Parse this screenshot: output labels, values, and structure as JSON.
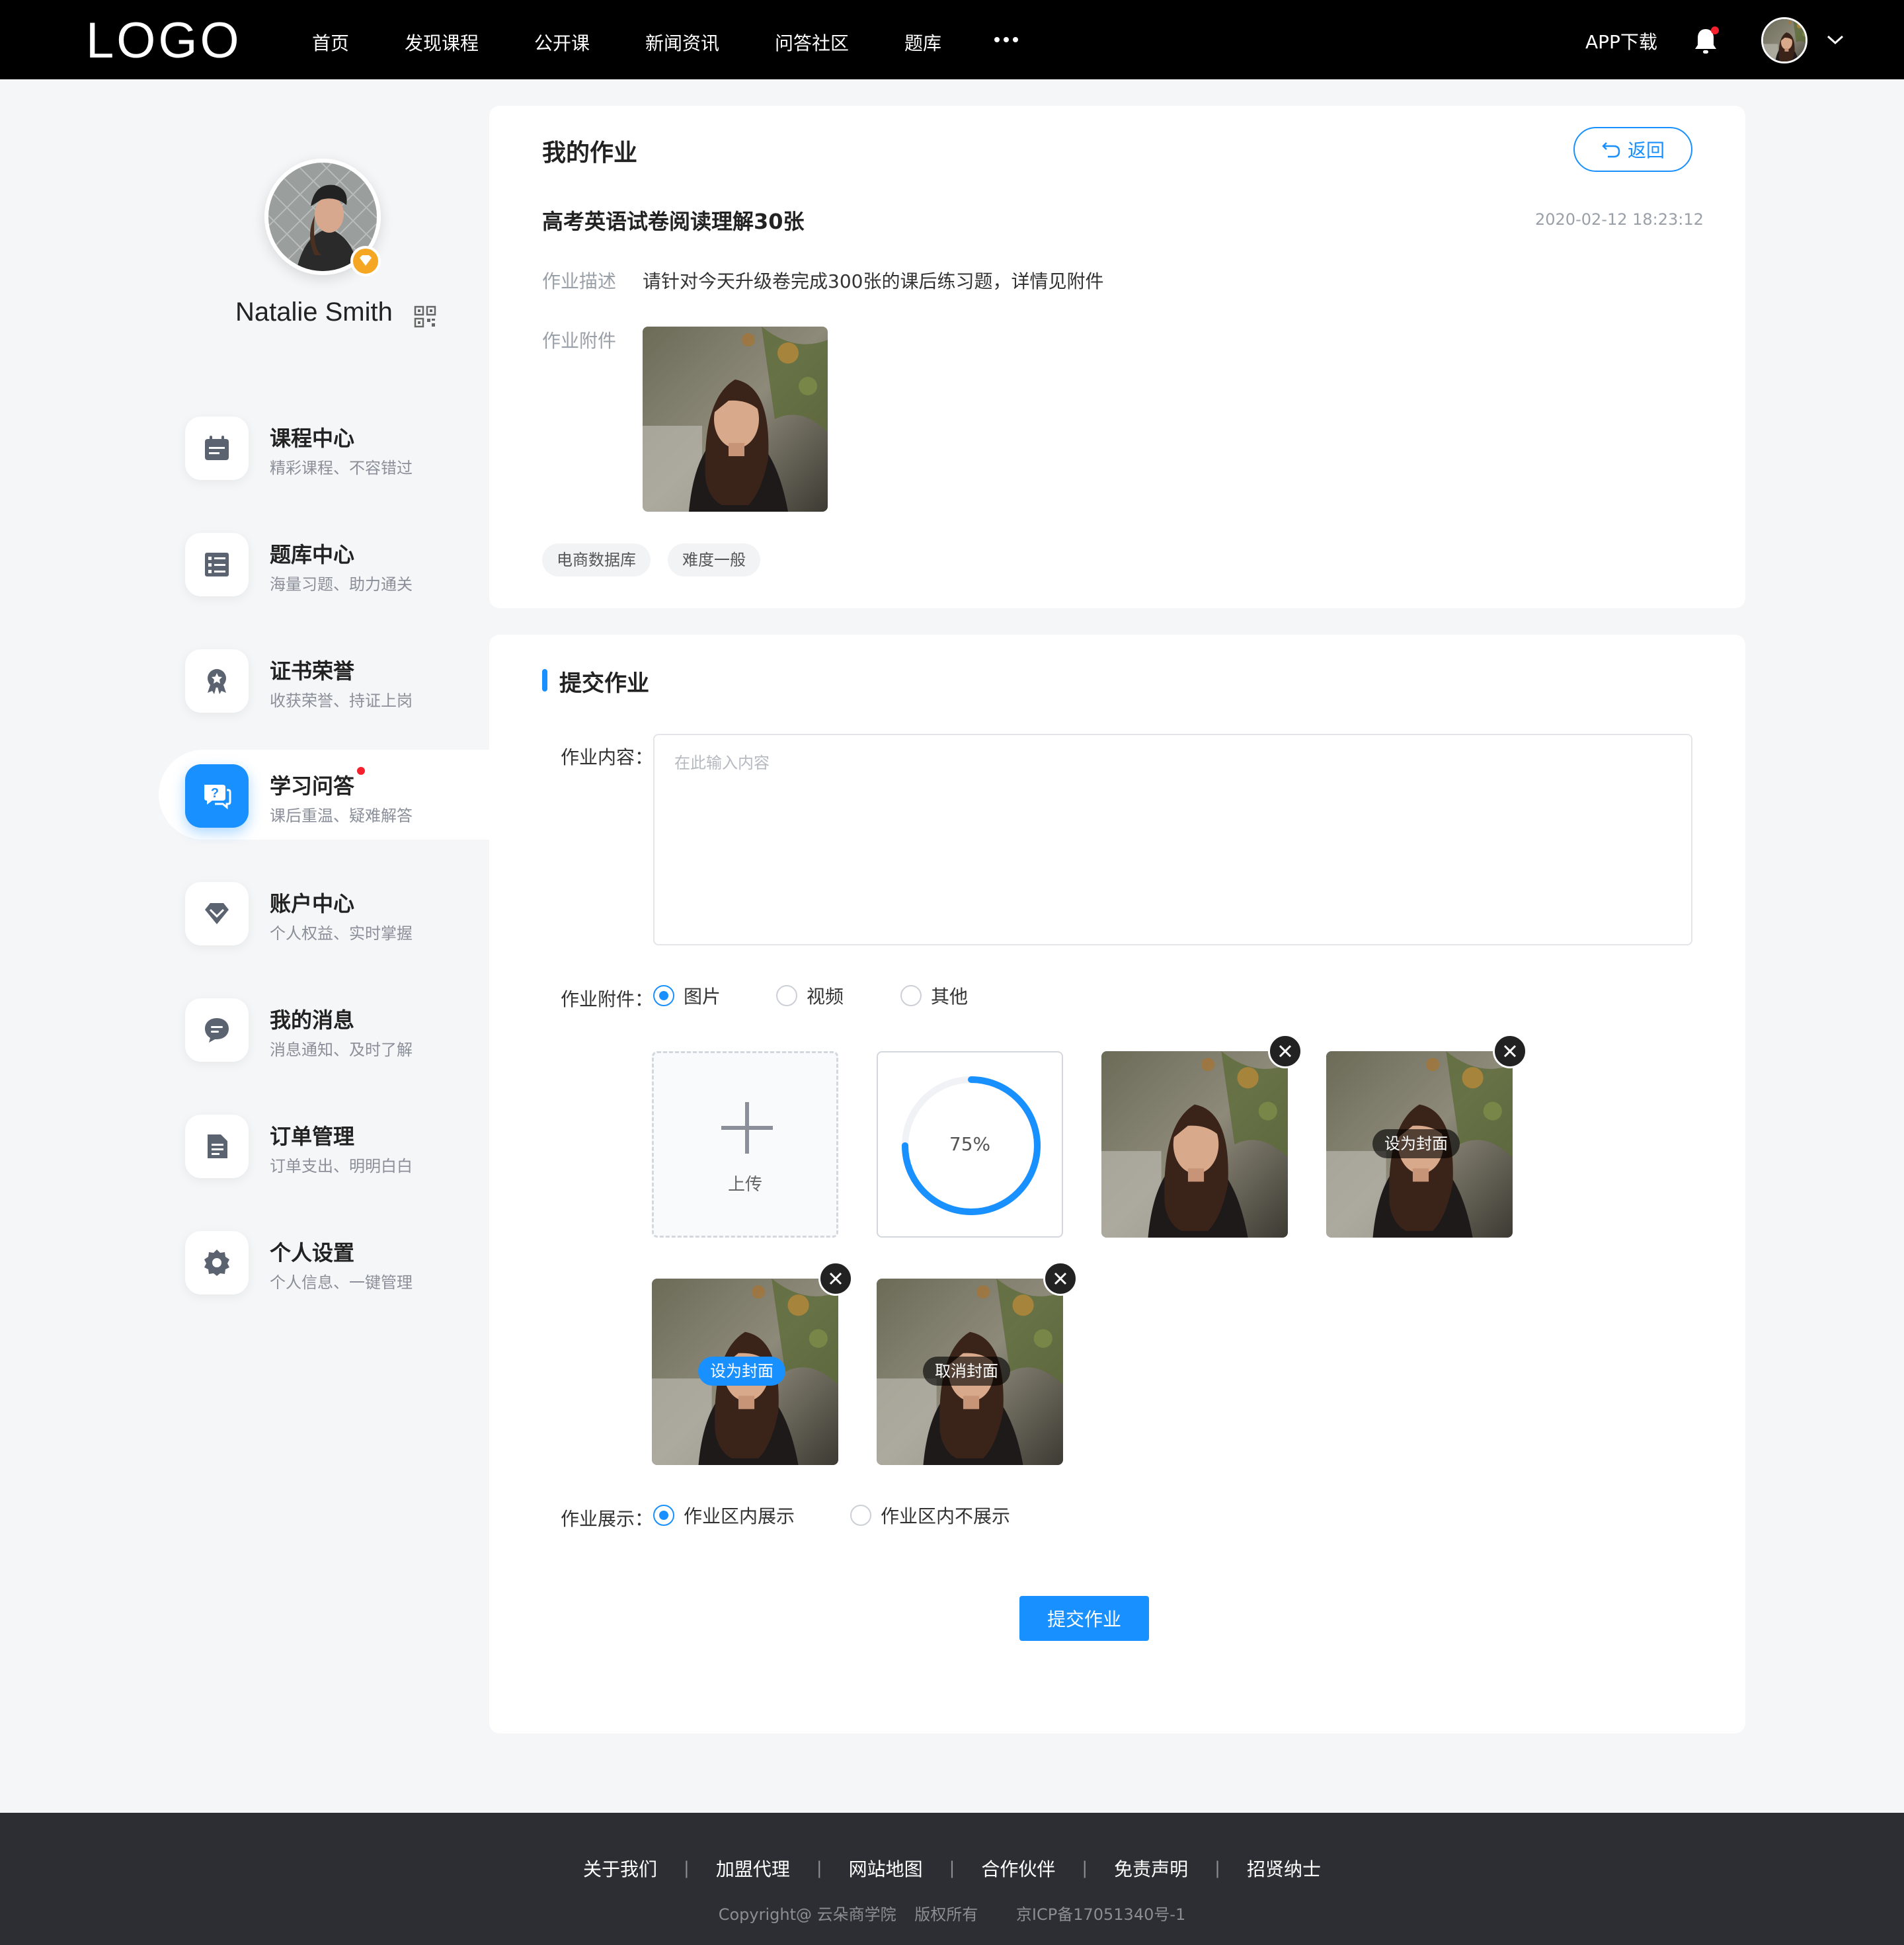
{
  "header": {
    "logo": "LOGO",
    "nav": [
      "首页",
      "发现课程",
      "公开课",
      "新闻资讯",
      "问答社区",
      "题库"
    ],
    "app_download": "APP下载"
  },
  "profile": {
    "name": "Natalie Smith"
  },
  "sidebar": {
    "items": [
      {
        "title": "课程中心",
        "sub": "精彩课程、不容错过",
        "icon": "calendar-icon"
      },
      {
        "title": "题库中心",
        "sub": "海量习题、助力通关",
        "icon": "list-icon"
      },
      {
        "title": "证书荣誉",
        "sub": "收获荣誉、持证上岗",
        "icon": "award-icon"
      },
      {
        "title": "学习问答",
        "sub": "课后重温、疑难解答",
        "icon": "question-chat-icon"
      },
      {
        "title": "账户中心",
        "sub": "个人权益、实时掌握",
        "icon": "diamond-icon"
      },
      {
        "title": "我的消息",
        "sub": "消息通知、及时了解",
        "icon": "message-icon"
      },
      {
        "title": "订单管理",
        "sub": "订单支出、明明白白",
        "icon": "document-icon"
      },
      {
        "title": "个人设置",
        "sub": "个人信息、一键管理",
        "icon": "gear-icon"
      }
    ],
    "active_index": 3
  },
  "homework": {
    "card_title": "我的作业",
    "back_label": "返回",
    "title": "高考英语试卷阅读理解30张",
    "date": "2020-02-12 18:23:12",
    "desc_label": "作业描述",
    "desc": "请针对今天升级卷完成300张的课后练习题，详情见附件",
    "attach_label": "作业附件",
    "tags": [
      "电商数据库",
      "难度一般"
    ]
  },
  "submit_form": {
    "section_title": "提交作业",
    "content_label": "作业内容：",
    "content_placeholder": "在此输入内容",
    "content_value": "",
    "attach_label": "作业附件：",
    "attach_types": [
      "图片",
      "视频",
      "其他"
    ],
    "attach_selected": "图片",
    "upload_label": "上传",
    "upload_progress": 75,
    "upload_progress_text": "75%",
    "set_cover_label": "设为封面",
    "cancel_cover_label": "取消封面",
    "display_label": "作业展示：",
    "display_options": [
      "作业区内展示",
      "作业区内不展示"
    ],
    "display_selected": "作业区内展示",
    "submit_label": "提交作业"
  },
  "footer": {
    "links": [
      "关于我们",
      "加盟代理",
      "网站地图",
      "合作伙伴",
      "免责声明",
      "招贤纳士"
    ],
    "copyright": "Copyright@ 云朵商学院",
    "rights": "版权所有",
    "icp": "京ICP备17051340号-1"
  },
  "colors": {
    "accent": "#1890ff",
    "header_bg": "#000000",
    "footer_bg": "#2c2e33",
    "page_bg": "#f5f6f7",
    "notify_dot": "#f5222d"
  }
}
